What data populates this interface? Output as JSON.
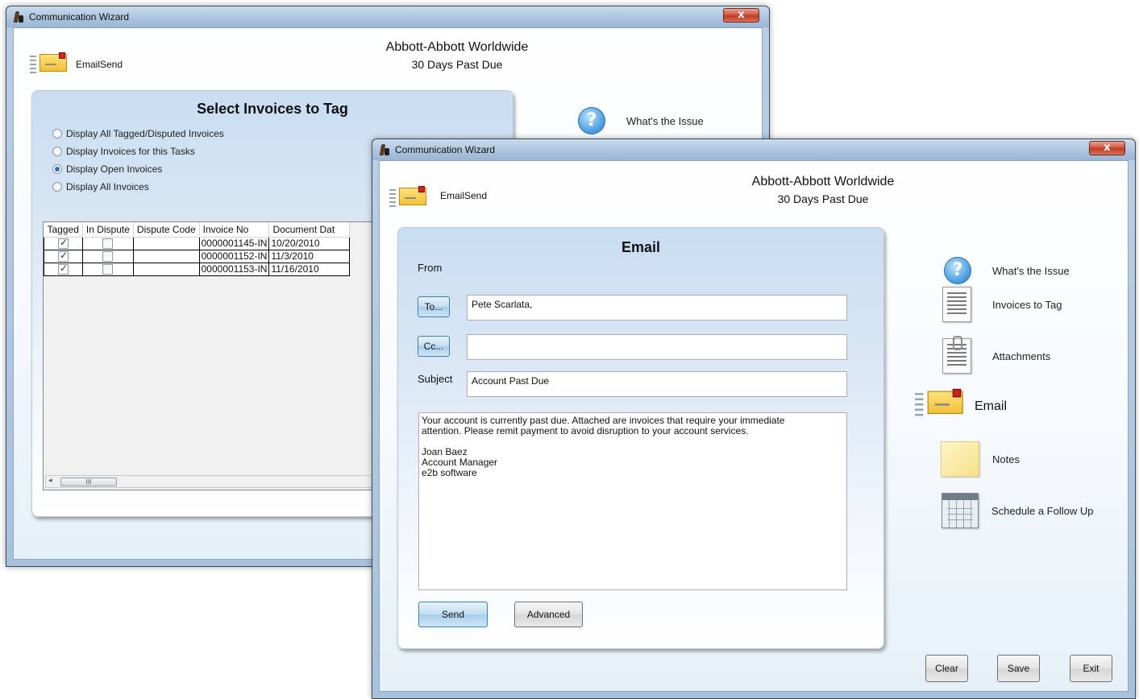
{
  "back_window": {
    "title": "Communication Wizard",
    "close_label": "x",
    "brand_label": "EmailSend",
    "company": "Abbott-Abbott Worldwide",
    "status": "30 Days Past Due",
    "panel_title": "Select Invoices to Tag",
    "radio_options": [
      {
        "label": "Display All Tagged/Disputed Invoices",
        "checked": false
      },
      {
        "label": "Display Invoices for this Tasks",
        "checked": false
      },
      {
        "label": "Display Open Invoices",
        "checked": true
      },
      {
        "label": "Display All Invoices",
        "checked": false
      }
    ],
    "table": {
      "columns": [
        "Tagged",
        "In Dispute",
        "Dispute Code",
        "Invoice No",
        "Document Dat"
      ],
      "rows": [
        {
          "tagged": true,
          "in_dispute": false,
          "dispute_code": "",
          "invoice_no": "0000001145-IN",
          "document_date": "10/20/2010"
        },
        {
          "tagged": true,
          "in_dispute": false,
          "dispute_code": "",
          "invoice_no": "0000001152-IN",
          "document_date": "11/3/2010"
        },
        {
          "tagged": true,
          "in_dispute": false,
          "dispute_code": "",
          "invoice_no": "0000001153-IN",
          "document_date": "11/16/2010"
        }
      ]
    },
    "scrollbar_grip": "III",
    "nav_first": "What's the Issue"
  },
  "front_window": {
    "title": "Communication Wizard",
    "close_label": "x",
    "brand_label": "EmailSend",
    "company": "Abbott-Abbott Worldwide",
    "status": "30 Days Past Due",
    "panel_title": "Email",
    "from_label": "From",
    "to_button": "To...",
    "to_value": "Pete Scarlata,",
    "cc_button": "Cc...",
    "cc_value": "",
    "subject_label": "Subject",
    "subject_value": "Account Past Due",
    "body": "Your account is currently past due. Attached are invoices that require your immediate\nattention. Please remit payment to avoid disruption to your account services.\n\nJoan Baez\nAccount Manager\ne2b software",
    "send_button": "Send",
    "advanced_button": "Advanced",
    "nav": [
      {
        "label": "What's the Issue",
        "icon": "question-icon"
      },
      {
        "label": "Invoices to Tag",
        "icon": "invoice-icon"
      },
      {
        "label": "Attachments",
        "icon": "attachment-icon"
      },
      {
        "label": "Email",
        "icon": "email-icon",
        "active": true
      },
      {
        "label": "Notes",
        "icon": "notes-icon"
      },
      {
        "label": "Schedule a Follow Up",
        "icon": "calendar-icon"
      }
    ],
    "footer": {
      "clear": "Clear",
      "save": "Save",
      "exit": "Exit"
    }
  }
}
